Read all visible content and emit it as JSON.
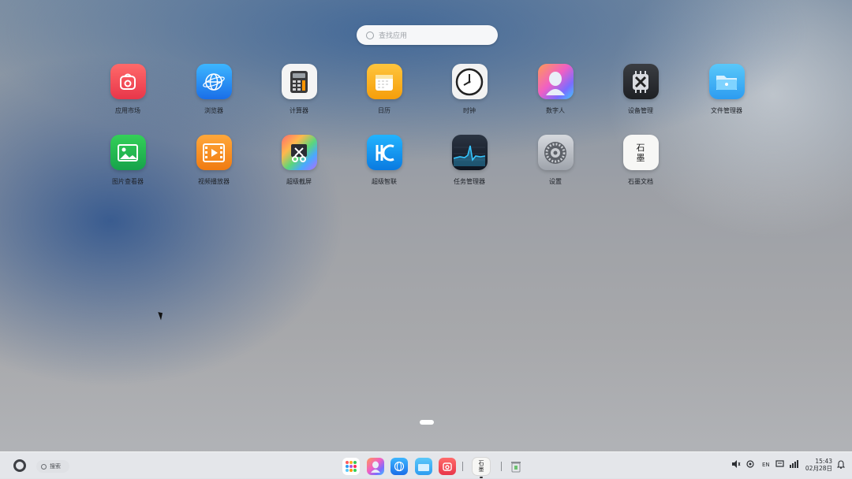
{
  "search": {
    "placeholder": "查找应用"
  },
  "apps": [
    {
      "label": "应用市场",
      "icon": "app-store-icon"
    },
    {
      "label": "浏览器",
      "icon": "browser-icon"
    },
    {
      "label": "计算器",
      "icon": "calculator-icon"
    },
    {
      "label": "日历",
      "icon": "calendar-icon"
    },
    {
      "label": "时钟",
      "icon": "clock-icon"
    },
    {
      "label": "数字人",
      "icon": "digital-human-icon"
    },
    {
      "label": "设备管理",
      "icon": "device-manager-icon"
    },
    {
      "label": "文件管理器",
      "icon": "file-manager-icon"
    },
    {
      "label": "图片查看器",
      "icon": "image-viewer-icon"
    },
    {
      "label": "视频播放器",
      "icon": "video-player-icon"
    },
    {
      "label": "超级截屏",
      "icon": "screenshot-icon"
    },
    {
      "label": "超级智联",
      "icon": "super-connect-icon"
    },
    {
      "label": "任务管理器",
      "icon": "task-manager-icon"
    },
    {
      "label": "设置",
      "icon": "settings-icon"
    },
    {
      "label": "石墨文档",
      "icon": "shimo-docs-icon",
      "glyphs": [
        "石",
        "墨"
      ]
    }
  ],
  "taskbar": {
    "search_label": "搜索",
    "dock_glyphs": [
      "石",
      "墨"
    ],
    "tray": {
      "ime": "EN"
    },
    "clock": {
      "time": "15:43",
      "date": "02月28日"
    }
  }
}
